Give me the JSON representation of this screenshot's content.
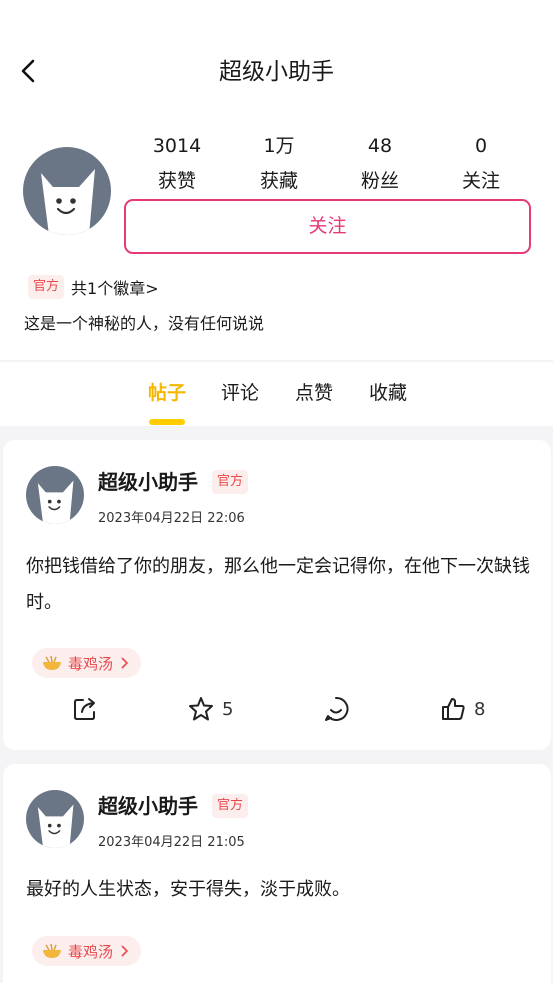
{
  "header": {
    "title": "超级小助手"
  },
  "profile": {
    "stats": [
      {
        "value": "3014",
        "label": "获赞"
      },
      {
        "value": "1万",
        "label": "获藏"
      },
      {
        "value": "48",
        "label": "粉丝"
      },
      {
        "value": "0",
        "label": "关注"
      }
    ],
    "follow_label": "关注",
    "official_badge": "官方",
    "medals_text": "共1个徽章>",
    "bio": "这是一个神秘的人，没有任何说说"
  },
  "tabs": [
    {
      "label": "帖子",
      "active": true
    },
    {
      "label": "评论",
      "active": false
    },
    {
      "label": "点赞",
      "active": false
    },
    {
      "label": "收藏",
      "active": false
    }
  ],
  "posts": [
    {
      "author": "超级小助手",
      "badge": "官方",
      "time": "2023年04月22日 22:06",
      "content": "你把钱借给了你的朋友，那么他一定会记得你，在他下一次缺钱时。",
      "tag": "毒鸡汤",
      "stars": "5",
      "likes": "8"
    },
    {
      "author": "超级小助手",
      "badge": "官方",
      "time": "2023年04月22日 21:05",
      "content": "最好的人生状态，安于得失，淡于成败。",
      "tag": "毒鸡汤"
    }
  ],
  "colors": {
    "accent_pink": "#e5397a",
    "tab_active": "#f5b800",
    "avatar_bg": "#6a7585",
    "badge_red": "#e8494c"
  }
}
